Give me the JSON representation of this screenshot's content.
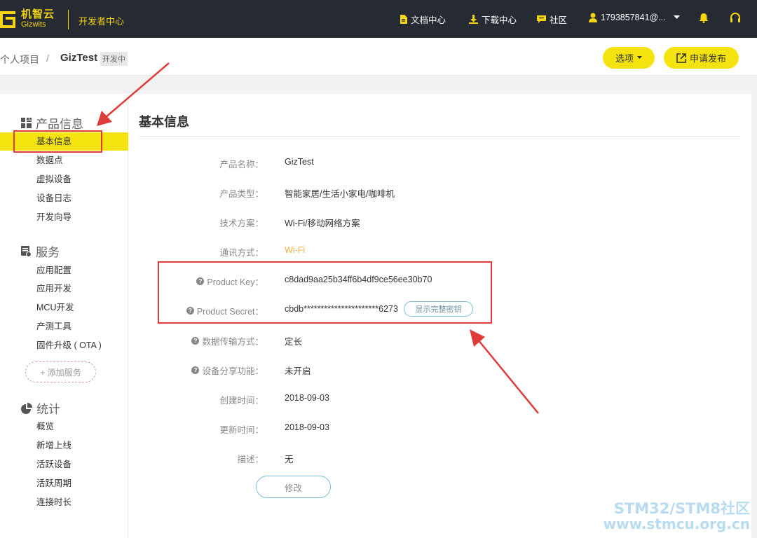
{
  "topbar": {
    "logo_cn": "机智云",
    "logo_en": "Gizwits",
    "dev_center": "开发者中心",
    "nav": {
      "docs": "文档中心",
      "download": "下载中心",
      "community": "社区",
      "user": "1793857841@..."
    }
  },
  "breadcrumb": {
    "root": "个人项目",
    "separator": "/",
    "current": "GizTest",
    "badge": "开发中"
  },
  "actions": {
    "options_label": "选项",
    "publish_label": "申请发布"
  },
  "sidebar": {
    "groups": [
      {
        "title": "产品信息",
        "icon": "grid-icon",
        "items": [
          "基本信息",
          "数据点",
          "虚拟设备",
          "设备日志",
          "开发向导"
        ]
      },
      {
        "title": "服务",
        "icon": "service-icon",
        "items": [
          "应用配置",
          "应用开发",
          "MCU开发",
          "产测工具",
          "固件升级 ( OTA )"
        ]
      },
      {
        "title": "统计",
        "icon": "pie-chart-icon",
        "items": [
          "概览",
          "新增上线",
          "活跃设备",
          "活跃周期",
          "连接时长"
        ]
      }
    ],
    "active_item": "基本信息",
    "add_service": "+ 添加服务"
  },
  "content": {
    "title": "基本信息",
    "rows": [
      {
        "label": "产品名称：",
        "value": "GizTest"
      },
      {
        "label": "产品类型：",
        "value": "智能家居/生活小家电/咖啡机"
      },
      {
        "label": "技术方案：",
        "value": "Wi-Fi/移动网络方案"
      },
      {
        "label": "通讯方式：",
        "value": "Wi-Fi"
      },
      {
        "label": "Product Key：",
        "value": "c8dad9aa25b34ff6b4df9ce56ee30b70"
      },
      {
        "label": "Product Secret：",
        "value": "cbdb**********************6273"
      },
      {
        "label": "数据传输方式：",
        "value": "定长"
      },
      {
        "label": "设备分享功能：",
        "value": "未开启"
      },
      {
        "label": "创建时间：",
        "value": "2018-09-03"
      },
      {
        "label": "更新时间：",
        "value": "2018-09-03"
      },
      {
        "label": "描述：",
        "value": "无"
      }
    ],
    "show_key_label": "显示完整密钥",
    "edit_label": "修改"
  },
  "colors": {
    "accent_yellow": "#f5e30f",
    "topbar_bg": "#262a33",
    "highlight_red": "#e03c3c",
    "wifi_orange": "#f0b04a"
  },
  "watermark": {
    "line1": "STM32/STM8社区",
    "line2": "www.stmcu.org.cn"
  }
}
